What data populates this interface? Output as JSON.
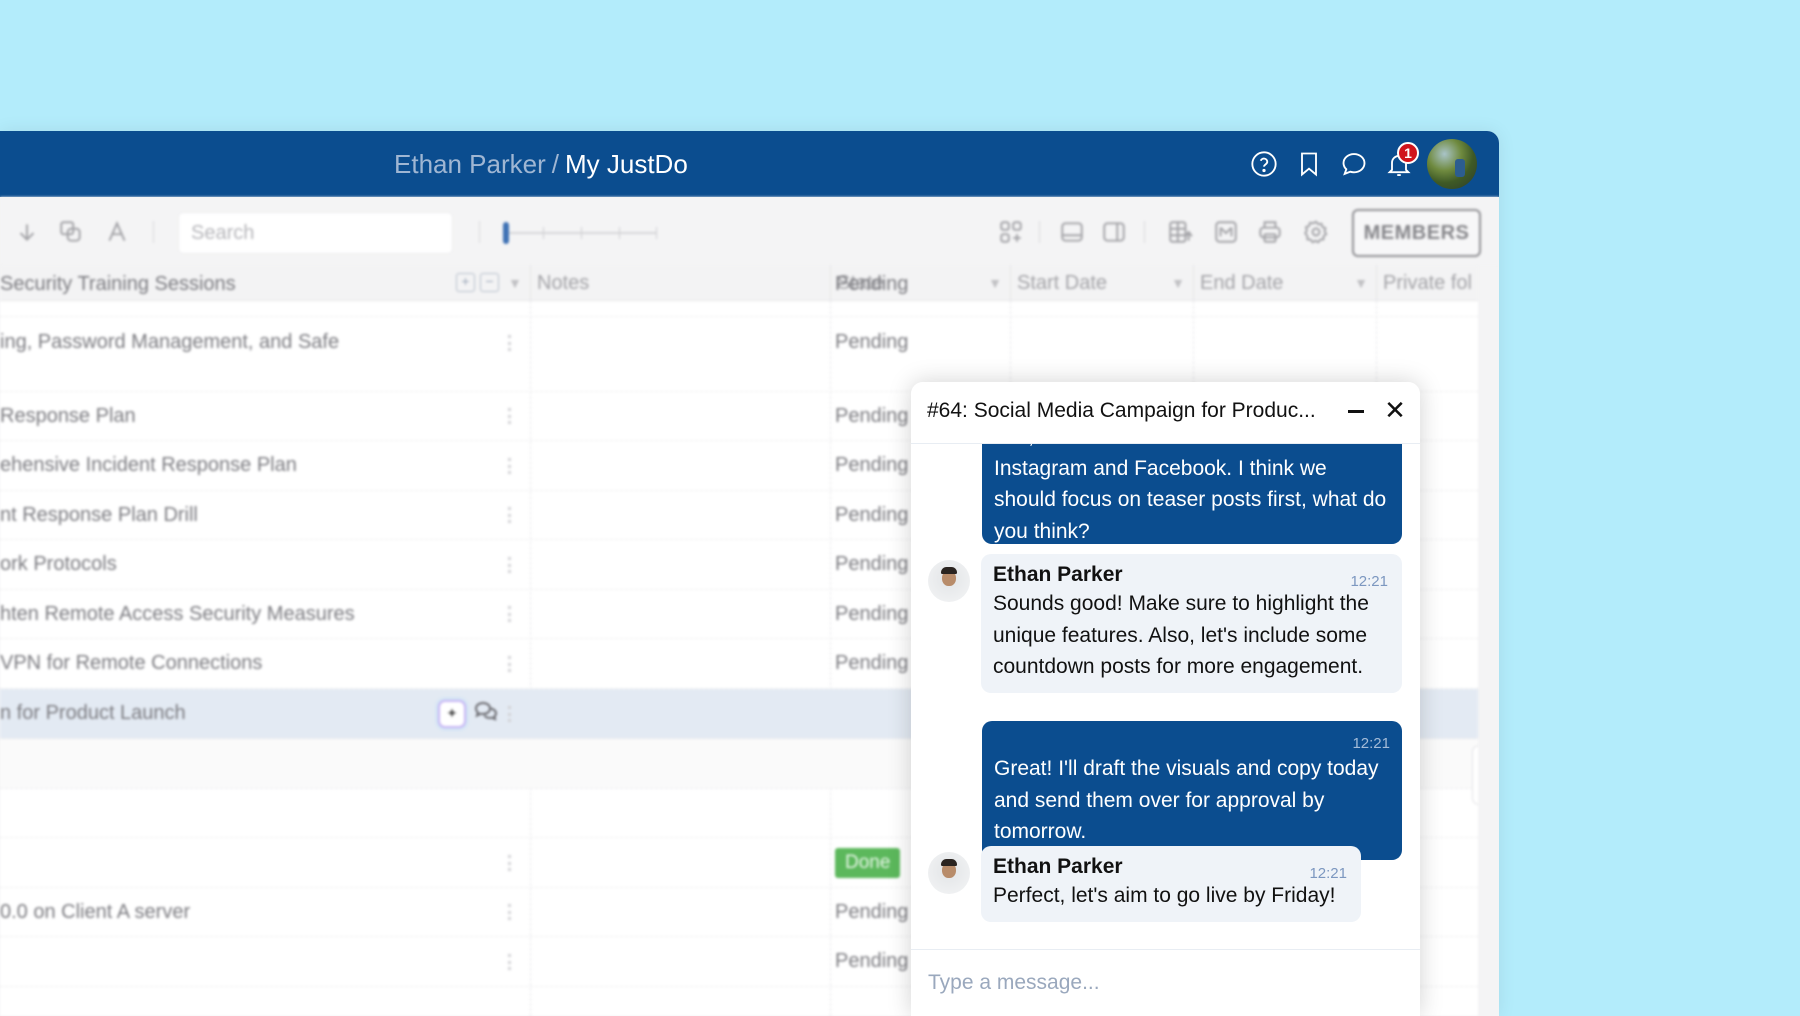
{
  "header": {
    "workspace_owner": "Ethan Parker",
    "separator": "/",
    "project": "My JustDo",
    "notification_count": "1",
    "icons": [
      "help-icon",
      "bookmark-icon",
      "chat-icon",
      "bell-icon"
    ]
  },
  "toolbar": {
    "search_placeholder": "Search",
    "members_label": "MEMBERS",
    "zoom_slider_value": 0,
    "icons_left": [
      "arrow-down-icon",
      "copy-icon",
      "font-icon"
    ],
    "icons_right": [
      "add-view-icon",
      "split-horizontal-icon",
      "split-vertical-icon",
      "add-column-icon",
      "email-icon",
      "print-icon",
      "settings-icon"
    ]
  },
  "grid": {
    "columns": [
      {
        "label": "Notes"
      },
      {
        "label": "State"
      },
      {
        "label": "Start Date"
      },
      {
        "label": "End Date"
      },
      {
        "label": "Private fol"
      }
    ],
    "rows": [
      {
        "title": "Security Training Sessions",
        "state": "Pending"
      },
      {
        "title": "ing, Password Management, and Safe",
        "state": "Pending"
      },
      {
        "title": " Response Plan",
        "state": "Pending"
      },
      {
        "title": "ehensive Incident Response Plan",
        "state": "Pending"
      },
      {
        "title": "nt Response Plan Drill",
        "state": "Pending"
      },
      {
        "title": "ork Protocols",
        "state": "Pending"
      },
      {
        "title": "hten Remote Access Security Measures",
        "state": "Pending"
      },
      {
        "title": "VPN for Remote Connections",
        "state": "Pending"
      },
      {
        "title": "n for Product Launch",
        "state": ""
      },
      {
        "title": "",
        "state": ""
      },
      {
        "title": "",
        "state": ""
      },
      {
        "title": "",
        "state": "Done"
      },
      {
        "title": "0.0 on Client A server",
        "state": "Pending"
      },
      {
        "title": "",
        "state": "Pending"
      }
    ]
  },
  "chat": {
    "title": "#64: Social Media Campaign for Produc...",
    "input_placeholder": "Type a message...",
    "messages": [
      {
        "direction": "out",
        "text": "Yes, I've outlined a few ideas for Instagram and Facebook. I think we should focus on teaser posts first, what do you think?",
        "time": ""
      },
      {
        "direction": "in",
        "sender": "Ethan Parker",
        "text": "Sounds good! Make sure to highlight the unique features. Also, let's include some countdown posts for more engagement.",
        "time": "12:21"
      },
      {
        "direction": "out",
        "text": "Great! I'll draft the visuals and copy today and send them over for approval by tomorrow.",
        "time": "12:21"
      },
      {
        "direction": "in",
        "sender": "Ethan Parker",
        "text": "Perfect, let's aim to go live by Friday!",
        "time": "12:21"
      }
    ]
  },
  "colors": {
    "background": "#b3ecfb",
    "header": "#0b4d8f",
    "outgoing_bubble": "#0b4d8f",
    "incoming_bubble": "#eff3f8",
    "done": "#5cb85c",
    "notification": "#d0141c",
    "selected_row": "#e3eaf3"
  }
}
